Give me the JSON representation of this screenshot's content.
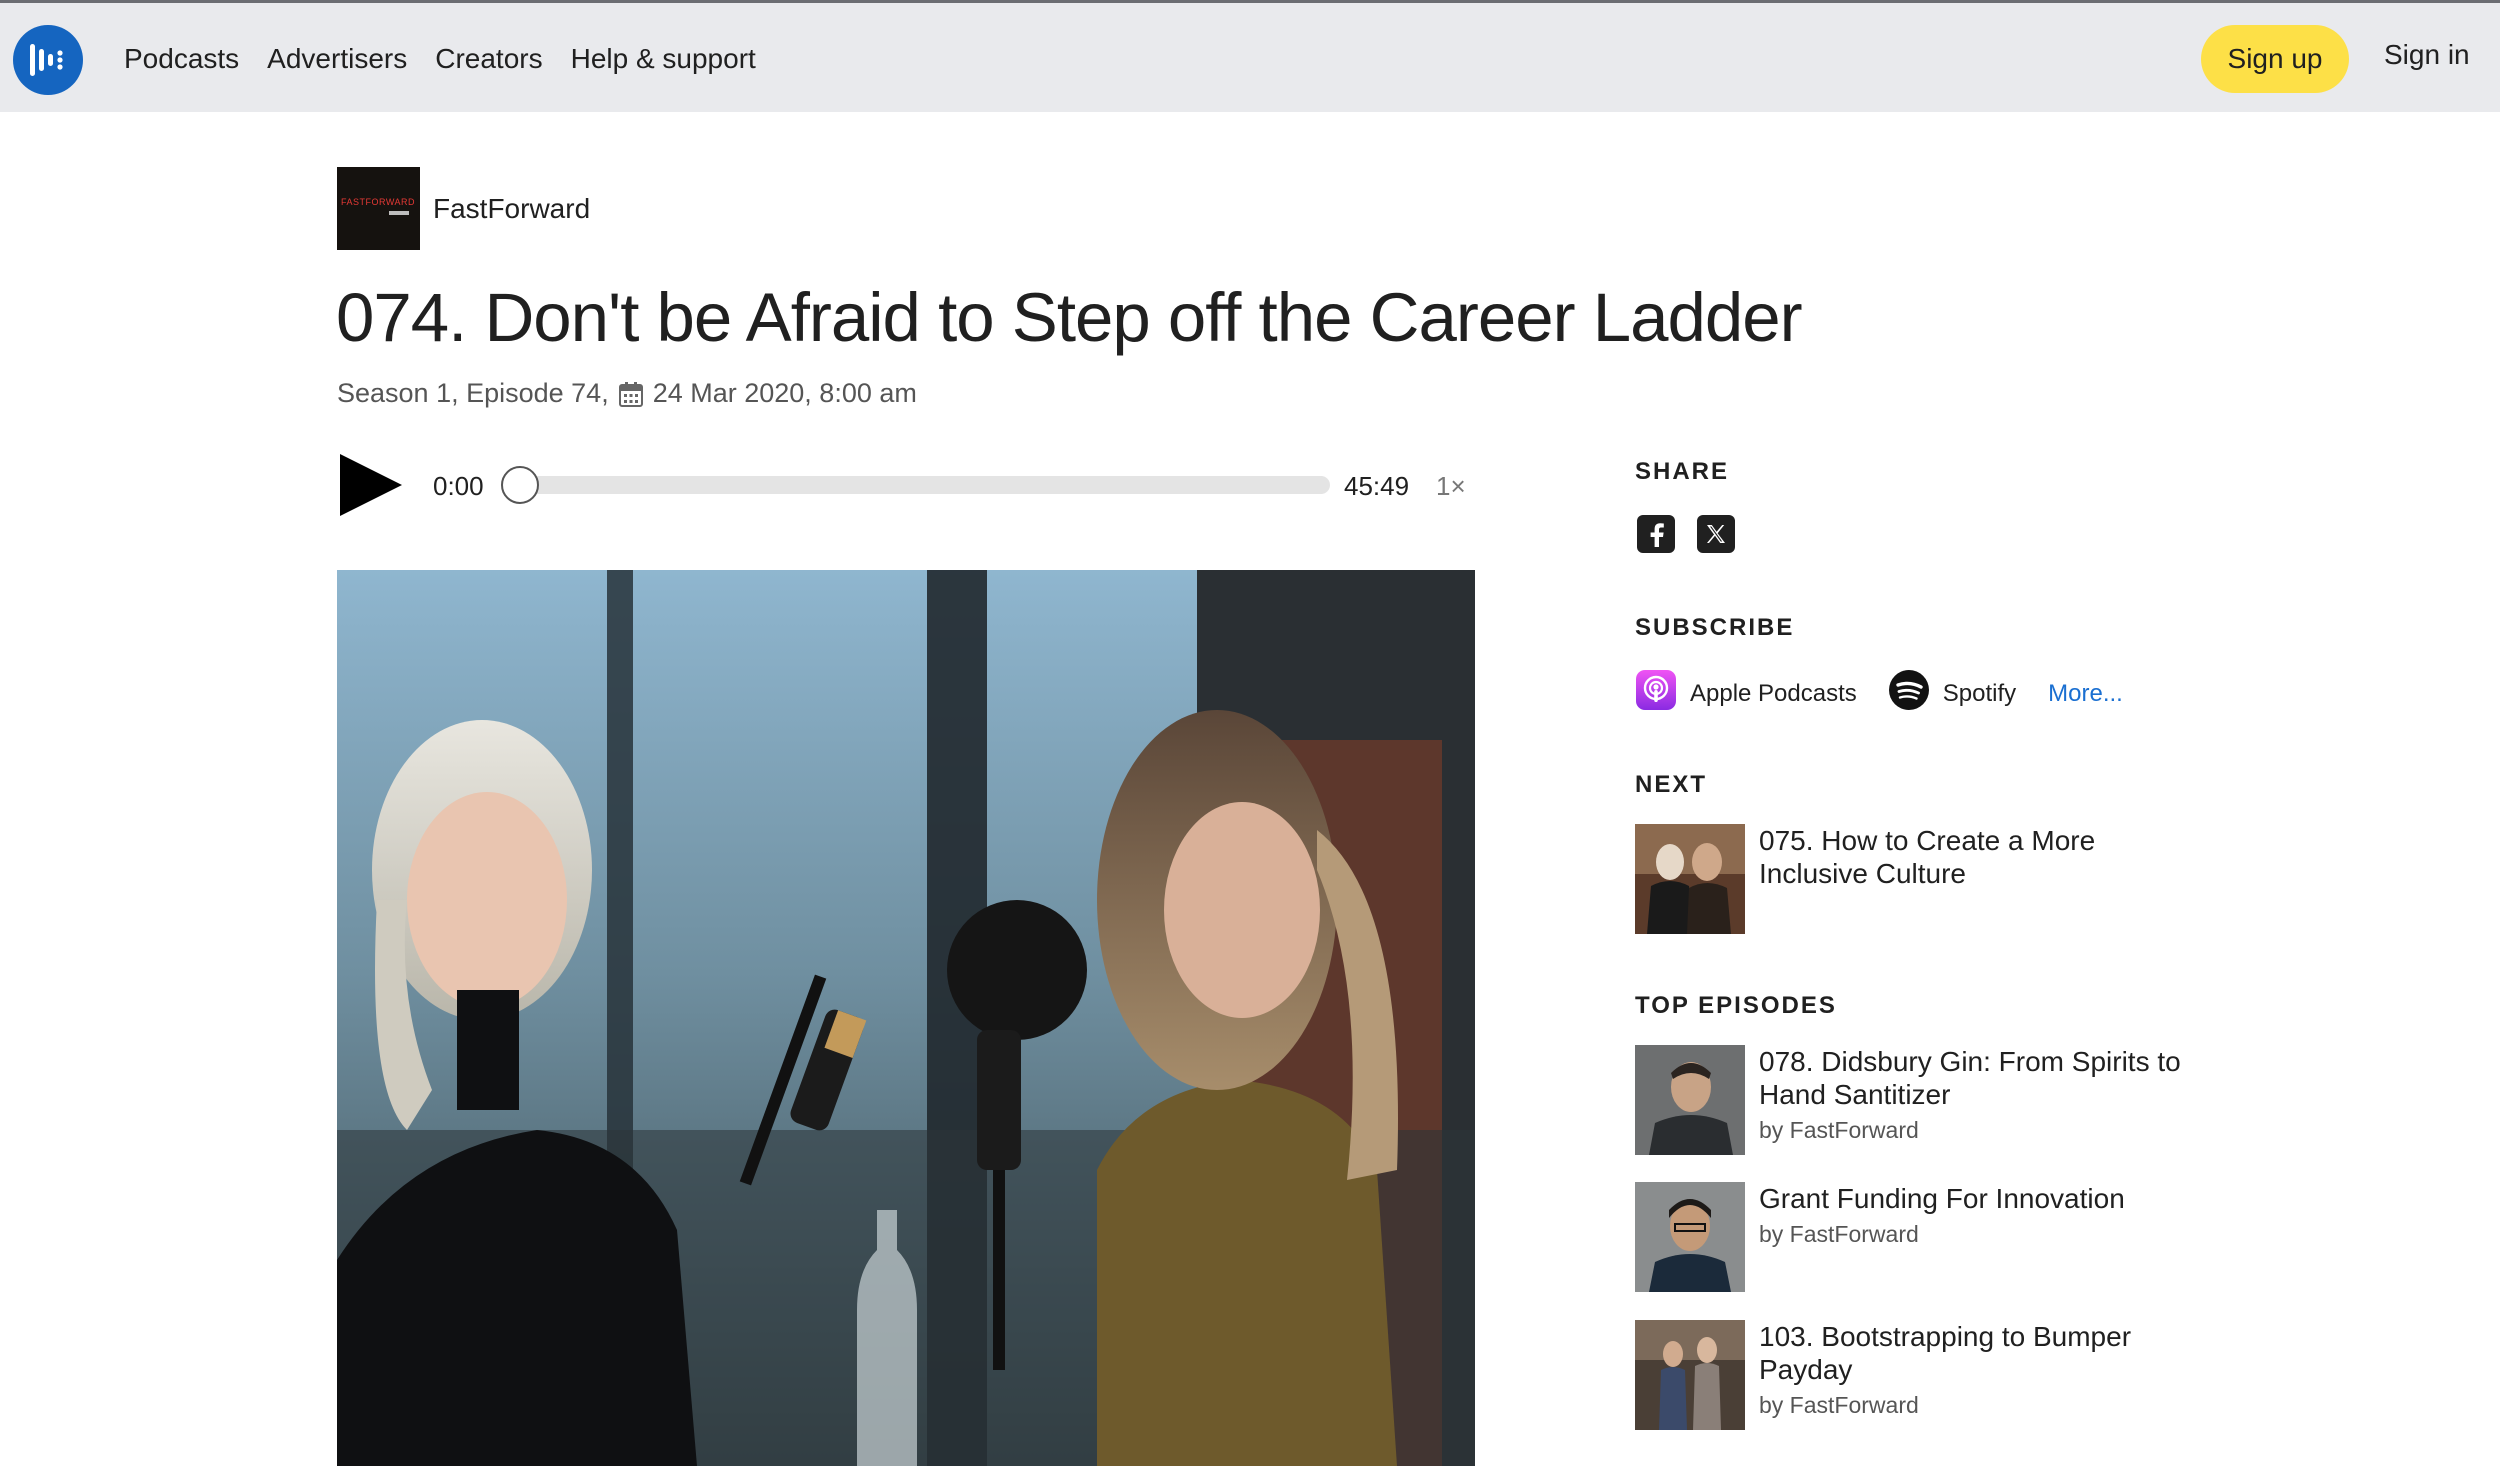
{
  "nav": {
    "items": [
      "Podcasts",
      "Advertisers",
      "Creators",
      "Help & support"
    ],
    "signup_label": "Sign up",
    "signin_label": "Sign in",
    "accent": "#fde047",
    "brand": "#1565c0"
  },
  "episode": {
    "show_name": "FastForward",
    "show_thumb_text": "FASTFORWARD",
    "title": "074. Don't be Afraid to Step off the Career Ladder",
    "season_episode": "Season 1, Episode 74,",
    "date": "24 Mar 2020, 8:00 am"
  },
  "player": {
    "current_time": "0:00",
    "total_time": "45:49",
    "speed": "1×",
    "progress": 0
  },
  "sidebar": {
    "share_heading": "SHARE",
    "share_icons": [
      "facebook-icon",
      "x-icon"
    ],
    "subscribe_heading": "SUBSCRIBE",
    "subscribe": [
      {
        "label": "Apple Podcasts",
        "icon": "apple-podcasts-icon"
      },
      {
        "label": "Spotify",
        "icon": "spotify-icon"
      }
    ],
    "more_label": "More...",
    "next_heading": "NEXT",
    "next_episode": {
      "title": "075. How to Create a More Inclusive Culture"
    },
    "top_heading": "TOP EPISODES",
    "top_episodes": [
      {
        "title": "078. Didsbury Gin: From Spirits to Hand Santitizer",
        "by": "by FastForward"
      },
      {
        "title": "Grant Funding For Innovation",
        "by": "by FastForward"
      },
      {
        "title": "103. Bootstrapping to Bumper Payday",
        "by": "by FastForward"
      }
    ]
  }
}
